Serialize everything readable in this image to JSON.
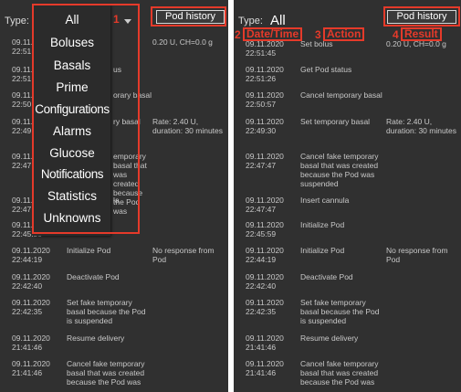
{
  "left": {
    "type_label": "Type:",
    "history_button": "Pod history",
    "annotation_num": "1",
    "dropdown_items": [
      "All",
      "Boluses",
      "Basals",
      "Prime",
      "Configurations",
      "Alarms",
      "Glucose",
      "Notifications",
      "Statistics",
      "Unknowns"
    ],
    "rows": [
      {
        "date": "09.11.2",
        "time": "22:51:4",
        "action": "",
        "result": "0.20 U, CH=0.0 g"
      },
      {
        "date": "09.11.2",
        "time": "22:51:2",
        "action": "us",
        "result": ""
      },
      {
        "date": "09.11.2",
        "time": "22:50:5",
        "action": "orary basal",
        "result": ""
      },
      {
        "date": "09.11.2",
        "time": "22:49:3",
        "action": "ry basal",
        "result": "Rate: 2.40 U, duration: 30 minutes"
      },
      {
        "date": "09.11.2",
        "time": "22:47:4",
        "action": "emporary basal that was created because the Pod was",
        "result": ""
      },
      {
        "date": "09.11.2",
        "time": "22:47:4",
        "action": "la",
        "result": ""
      },
      {
        "date": "09.11.2",
        "time": "22:45:59",
        "action": "",
        "result": ""
      },
      {
        "date": "09.11.2020",
        "time": "22:44:19",
        "action": "Initialize Pod",
        "result": "No response from Pod"
      },
      {
        "date": "09.11.2020",
        "time": "22:42:40",
        "action": "Deactivate Pod",
        "result": ""
      },
      {
        "date": "09.11.2020",
        "time": "22:42:35",
        "action": "Set fake temporary basal because the Pod is suspended",
        "result": ""
      },
      {
        "date": "09.11.2020",
        "time": "21:41:46",
        "action": "Resume delivery",
        "result": ""
      },
      {
        "date": "09.11.2020",
        "time": "21:41:46",
        "action": "Cancel fake temporary basal that was created because the Pod was",
        "result": ""
      }
    ]
  },
  "right": {
    "type_label": "Type:",
    "type_value": "All",
    "history_button": "Pod history",
    "annotations": {
      "n2": "2",
      "date_time": "Date/Time",
      "n3": "3",
      "action": "Action",
      "n4": "4",
      "result": "Result"
    },
    "rows": [
      {
        "date": "09.11.2020",
        "time": "22:51:45",
        "action": "Set bolus",
        "result": "0.20 U, CH=0.0 g"
      },
      {
        "date": "09.11.2020",
        "time": "22:51:26",
        "action": "Get Pod status",
        "result": ""
      },
      {
        "date": "09.11.2020",
        "time": "22:50:57",
        "action": "Cancel temporary basal",
        "result": ""
      },
      {
        "date": "09.11.2020",
        "time": "22:49:30",
        "action": "Set temporary basal",
        "result": "Rate: 2.40 U, duration: 30 minutes"
      },
      {
        "date": "09.11.2020",
        "time": "22:47:47",
        "action": "Cancel fake temporary basal that was created because the Pod was suspended",
        "result": ""
      },
      {
        "date": "09.11.2020",
        "time": "22:47:47",
        "action": "Insert cannula",
        "result": ""
      },
      {
        "date": "09.11.2020",
        "time": "22:45:59",
        "action": "Initialize Pod",
        "result": ""
      },
      {
        "date": "09.11.2020",
        "time": "22:44:19",
        "action": "Initialize Pod",
        "result": "No response from Pod"
      },
      {
        "date": "09.11.2020",
        "time": "22:42:40",
        "action": "Deactivate Pod",
        "result": ""
      },
      {
        "date": "09.11.2020",
        "time": "22:42:35",
        "action": "Set fake temporary basal because the Pod is suspended",
        "result": ""
      },
      {
        "date": "09.11.2020",
        "time": "21:41:46",
        "action": "Resume delivery",
        "result": ""
      },
      {
        "date": "09.11.2020",
        "time": "21:41:46",
        "action": "Cancel fake temporary basal that was created because the Pod was",
        "result": ""
      }
    ]
  },
  "colors": {
    "background": "#303030",
    "annotation": "#e53a2a",
    "dropdown": "#2b2b2b"
  }
}
